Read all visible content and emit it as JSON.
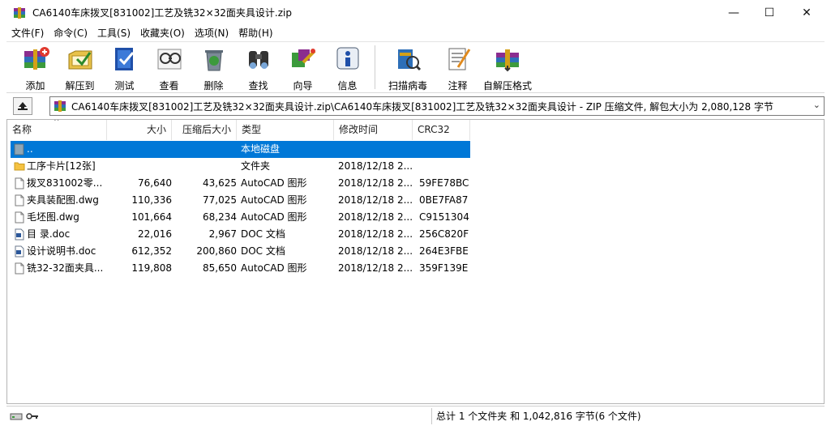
{
  "window": {
    "title": "CA6140车床拨叉[831002]工艺及铣32×32面夹具设计.zip",
    "minimize_glyph": "—",
    "maximize_glyph": "☐",
    "close_glyph": "✕"
  },
  "menu": [
    "文件(F)",
    "命令(C)",
    "工具(S)",
    "收藏夹(O)",
    "选项(N)",
    "帮助(H)"
  ],
  "toolbar": [
    {
      "label": "添加",
      "icon": "add-archive-icon"
    },
    {
      "label": "解压到",
      "icon": "extract-to-icon"
    },
    {
      "label": "测试",
      "icon": "test-icon"
    },
    {
      "label": "查看",
      "icon": "view-icon"
    },
    {
      "label": "删除",
      "icon": "delete-icon"
    },
    {
      "label": "查找",
      "icon": "find-icon"
    },
    {
      "label": "向导",
      "icon": "wizard-icon"
    },
    {
      "label": "信息",
      "icon": "info-icon"
    },
    {
      "label": "扫描病毒",
      "icon": "virus-scan-icon"
    },
    {
      "label": "注释",
      "icon": "comment-icon"
    },
    {
      "label": "自解压格式",
      "icon": "sfx-icon"
    }
  ],
  "address": {
    "path": "CA6140车床拨叉[831002]工艺及铣32×32面夹具设计.zip\\CA6140车床拨叉[831002]工艺及铣32×32面夹具设计 - ZIP 压缩文件, 解包大小为 2,080,128 字节"
  },
  "columns": {
    "name": "名称",
    "size": "大小",
    "packed": "压缩后大小",
    "type": "类型",
    "modified": "修改时间",
    "crc": "CRC32"
  },
  "files": [
    {
      "name": "..",
      "size": "",
      "packed": "",
      "type": "本地磁盘",
      "modified": "",
      "crc": "",
      "icon": "parent-folder-icon",
      "selected": true
    },
    {
      "name": "工序卡片[12张]",
      "size": "",
      "packed": "",
      "type": "文件夹",
      "modified": "2018/12/18 2...",
      "crc": "",
      "icon": "folder-icon",
      "selected": false
    },
    {
      "name": "拨叉831002零...",
      "size": "76,640",
      "packed": "43,625",
      "type": "AutoCAD 图形",
      "modified": "2018/12/18 2...",
      "crc": "59FE78BC",
      "icon": "file-icon",
      "selected": false
    },
    {
      "name": "夹具装配图.dwg",
      "size": "110,336",
      "packed": "77,025",
      "type": "AutoCAD 图形",
      "modified": "2018/12/18 2...",
      "crc": "0BE7FA87",
      "icon": "file-icon",
      "selected": false
    },
    {
      "name": "毛坯图.dwg",
      "size": "101,664",
      "packed": "68,234",
      "type": "AutoCAD 图形",
      "modified": "2018/12/18 2...",
      "crc": "C9151304",
      "icon": "file-icon",
      "selected": false
    },
    {
      "name": "目 录.doc",
      "size": "22,016",
      "packed": "2,967",
      "type": "DOC 文档",
      "modified": "2018/12/18 2...",
      "crc": "256C820F",
      "icon": "word-doc-icon",
      "selected": false
    },
    {
      "name": "设计说明书.doc",
      "size": "612,352",
      "packed": "200,860",
      "type": "DOC 文档",
      "modified": "2018/12/18 2...",
      "crc": "264E3FBE",
      "icon": "word-doc-icon",
      "selected": false
    },
    {
      "name": "铣32-32面夹具...",
      "size": "119,808",
      "packed": "85,650",
      "type": "AutoCAD 图形",
      "modified": "2018/12/18 2...",
      "crc": "359F139E",
      "icon": "file-icon",
      "selected": false
    }
  ],
  "status": {
    "summary": "总计 1 个文件夹 和 1,042,816 字节(6 个文件)"
  },
  "colors": {
    "selection": "#0078d7",
    "folder": "#f5c242",
    "word_blue": "#2b579a"
  }
}
